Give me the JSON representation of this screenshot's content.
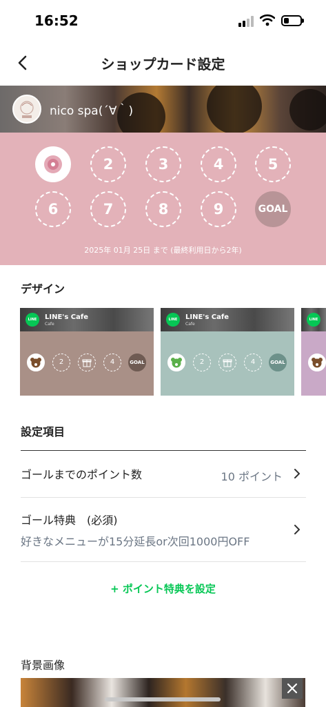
{
  "status_bar": {
    "time": "16:52",
    "battery_level": 0.3
  },
  "nav": {
    "title": "ショップカード設定",
    "back_icon": "chevron-left-icon"
  },
  "card": {
    "shop_name": "nico spa(´∀｀)",
    "stamp_color": "#e3b2b9",
    "stamps": [
      "",
      "2",
      "3",
      "4",
      "5",
      "6",
      "7",
      "8",
      "9",
      "GOAL"
    ],
    "expiry": "2025年 01月 25日 まで (最終利用日から2年)"
  },
  "design": {
    "title": "デザイン",
    "brand": "LINE's Cafe",
    "sub": "Cafe",
    "mini_stamps": [
      "",
      "2",
      "",
      "4",
      "GOAL"
    ],
    "options": [
      {
        "color": "#a99087",
        "goal_color": "#6f5b53"
      },
      {
        "color": "#a8c2bc",
        "goal_color": "#6d918a"
      },
      {
        "color": "#c9a9c7",
        "goal_color": "#8e6f8c"
      }
    ]
  },
  "settings": {
    "title": "設定項目",
    "goal_points_label": "ゴールまでのポイント数",
    "goal_points_value": "10 ポイント",
    "goal_reward_label": "ゴール特典　(必須)",
    "goal_reward_value": "好きなメニューが15分延長or次回1000円OFF",
    "add_point_reward": "+ ポイント特典を設定"
  },
  "background": {
    "title": "背景画像"
  }
}
